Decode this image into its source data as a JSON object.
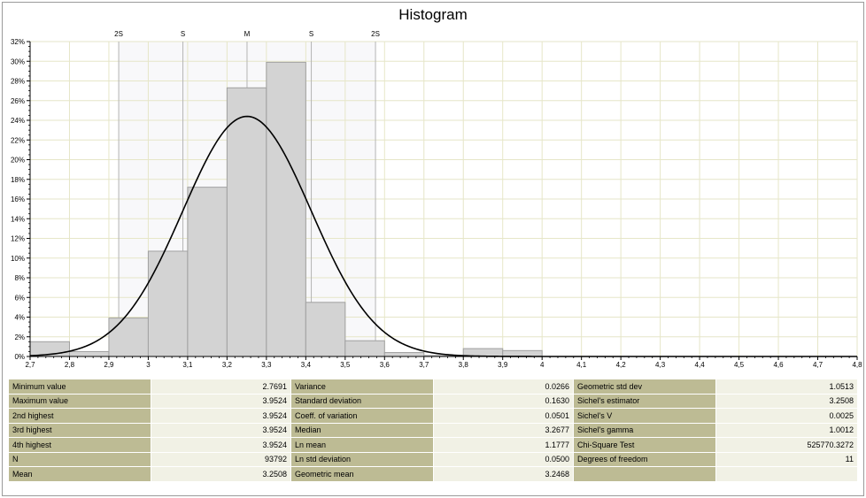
{
  "chart_data": {
    "type": "bar",
    "title": "Histogram",
    "xlim": [
      2.7,
      4.8
    ],
    "ylim": [
      0,
      32
    ],
    "x_ticks": [
      "2,7",
      "2,8",
      "2,9",
      "3",
      "3,1",
      "3,2",
      "3,3",
      "3,4",
      "3,5",
      "3,6",
      "3,7",
      "3,8",
      "3,9",
      "4",
      "4,1",
      "4,2",
      "4,3",
      "4,4",
      "4,5",
      "4,6",
      "4,7",
      "4,8"
    ],
    "y_ticks": [
      "0%",
      "2%",
      "4%",
      "6%",
      "8%",
      "10%",
      "12%",
      "14%",
      "16%",
      "18%",
      "20%",
      "22%",
      "24%",
      "26%",
      "28%",
      "30%",
      "32%"
    ],
    "bins": [
      {
        "x0": 2.7,
        "x1": 2.8,
        "value": 1.5
      },
      {
        "x0": 2.8,
        "x1": 2.9,
        "value": 0.5
      },
      {
        "x0": 2.9,
        "x1": 3.0,
        "value": 3.9
      },
      {
        "x0": 3.0,
        "x1": 3.1,
        "value": 10.7
      },
      {
        "x0": 3.1,
        "x1": 3.2,
        "value": 17.2
      },
      {
        "x0": 3.2,
        "x1": 3.3,
        "value": 27.3
      },
      {
        "x0": 3.3,
        "x1": 3.4,
        "value": 29.9
      },
      {
        "x0": 3.4,
        "x1": 3.5,
        "value": 5.5
      },
      {
        "x0": 3.5,
        "x1": 3.6,
        "value": 1.6
      },
      {
        "x0": 3.6,
        "x1": 3.7,
        "value": 0.4
      },
      {
        "x0": 3.7,
        "x1": 3.8,
        "value": 0.1
      },
      {
        "x0": 3.8,
        "x1": 3.9,
        "value": 0.8
      },
      {
        "x0": 3.9,
        "x1": 4.0,
        "value": 0.6
      }
    ],
    "normal_curve": {
      "mean": 3.2508,
      "std": 0.163,
      "peak": 24.4
    },
    "markers": [
      {
        "label": "2S",
        "x": 2.925
      },
      {
        "label": "S",
        "x": 3.088
      },
      {
        "label": "M",
        "x": 3.2508
      },
      {
        "label": "S",
        "x": 3.414
      },
      {
        "label": "2S",
        "x": 3.577
      }
    ],
    "shaded_range": [
      2.925,
      3.577
    ],
    "grid": true,
    "colors": {
      "bar_fill": "#d3d3d3",
      "bar_stroke": "#a0a0a0",
      "grid": "#e6e6c8",
      "curve": "#000000",
      "marker": "#b4b4b4",
      "shade": "#f8f8fa"
    }
  },
  "stats_table": [
    [
      "Minimum value",
      "2.7691",
      "Variance",
      "0.0266",
      "Geometric std dev",
      "1.0513"
    ],
    [
      "Maximum value",
      "3.9524",
      "Standard deviation",
      "0.1630",
      "Sichel's estimator",
      "3.2508"
    ],
    [
      "2nd highest",
      "3.9524",
      "Coeff. of variation",
      "0.0501",
      "Sichel's V",
      "0.0025"
    ],
    [
      "3rd highest",
      "3.9524",
      "Median",
      "3.2677",
      "Sichel's gamma",
      "1.0012"
    ],
    [
      "4th highest",
      "3.9524",
      "Ln mean",
      "1.1777",
      "Chi-Square Test",
      "525770.3272"
    ],
    [
      "N",
      "93792",
      "Ln std deviation",
      "0.0500",
      "Degrees of freedom",
      "11"
    ],
    [
      "Mean",
      "3.2508",
      "Geometric mean",
      "3.2468",
      "",
      ""
    ]
  ]
}
